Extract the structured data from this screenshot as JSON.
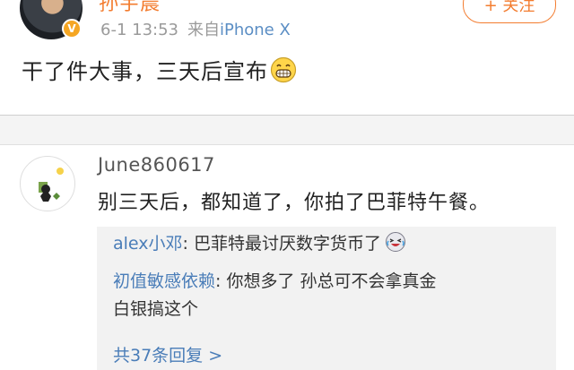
{
  "post": {
    "author": "孙宇晨",
    "time": "6-1 13:53",
    "source_prefix": "来自",
    "source": "iPhone X",
    "follow_label": "+ 关注",
    "text": "干了件大事，三天后宣布",
    "emoji": "grin-emoji"
  },
  "comment": {
    "user": "June860617",
    "text": "别三天后，都知道了，你拍了巴菲特午餐。",
    "replies": [
      {
        "user": "alex小邓",
        "sep": ": ",
        "text": "巴菲特最讨厌数字货币了",
        "emoji": "laugh-cry-emoji"
      },
      {
        "user": "初值敏感依赖",
        "sep": ": ",
        "text_line1": "你想多了  孙总可不会拿真金",
        "text_line2": "白银搞这个"
      }
    ],
    "more_replies": "共37条回复 >"
  },
  "colors": {
    "accent": "#f37c2f",
    "link": "#4a7db8",
    "meta": "#9a9a9a",
    "reply_bg": "#f2f2f2"
  }
}
